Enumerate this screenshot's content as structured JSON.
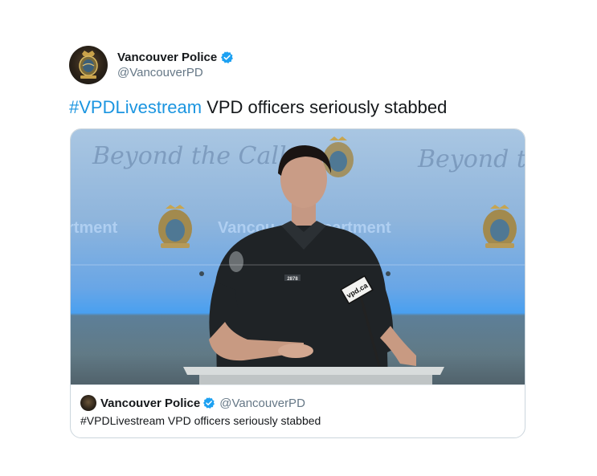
{
  "account": {
    "display_name": "Vancouver Police",
    "handle": "@VancouverPD",
    "verified": true
  },
  "tweet": {
    "hashtag": "#VPDLivestream",
    "text": " VPD officers seriously stabbed"
  },
  "media": {
    "backdrop_left": "Beyond the Call",
    "backdrop_right": "Beyond th",
    "dept_left": "rtment",
    "dept_center": "Vancou    ce Department",
    "badge_number": "2878",
    "mic_label": "vpd.ca"
  },
  "quote": {
    "display_name": "Vancouver Police",
    "handle": "@VancouverPD",
    "text": "#VPDLivestream VPD officers seriously stabbed"
  },
  "colors": {
    "hashtag": "#1b95e0",
    "verified": "#1da1f2",
    "text": "#14171a",
    "secondary": "#657786",
    "border": "#ccd6dd"
  }
}
